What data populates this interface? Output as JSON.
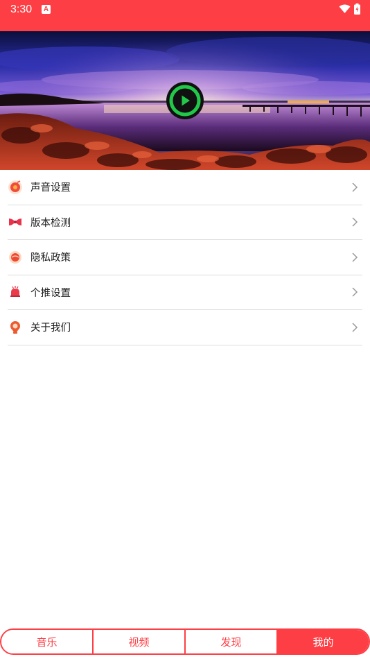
{
  "status_bar": {
    "time": "3:30",
    "notification_icon": "A",
    "icons": [
      "wifi-icon",
      "battery-icon"
    ]
  },
  "banner": {
    "play_icon": "play-icon"
  },
  "menu": {
    "items": [
      {
        "label": "声音设置",
        "icon": "sound-icon"
      },
      {
        "label": "版本检测",
        "icon": "version-icon"
      },
      {
        "label": "隐私政策",
        "icon": "privacy-icon"
      },
      {
        "label": "个推设置",
        "icon": "push-icon"
      },
      {
        "label": "关于我们",
        "icon": "about-icon"
      }
    ]
  },
  "tabs": [
    {
      "label": "音乐",
      "active": false
    },
    {
      "label": "视频",
      "active": false
    },
    {
      "label": "发现",
      "active": false
    },
    {
      "label": "我的",
      "active": true
    }
  ],
  "colors": {
    "accent": "#fd3f45",
    "play_green": "#22c84a"
  }
}
